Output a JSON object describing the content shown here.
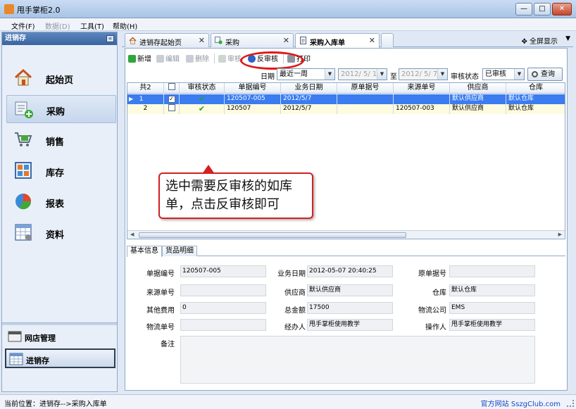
{
  "window": {
    "title": "甩手掌柜2.0",
    "min_label": "—",
    "max_label": "□",
    "close_label": "✕"
  },
  "menu": [
    {
      "label": "文件(F)",
      "disabled": false
    },
    {
      "label": "数据(D)",
      "disabled": true
    },
    {
      "label": "工具(T)",
      "disabled": false
    },
    {
      "label": "帮助(H)",
      "disabled": false
    }
  ],
  "sidebar": {
    "header": "进销存",
    "items": [
      {
        "label": "起始页",
        "icon": "home-icon"
      },
      {
        "label": "采购",
        "icon": "purchase-icon",
        "active": true
      },
      {
        "label": "销售",
        "icon": "cart-icon"
      },
      {
        "label": "库存",
        "icon": "inventory-icon"
      },
      {
        "label": "报表",
        "icon": "pie-chart-icon"
      },
      {
        "label": "资料",
        "icon": "data-grid-icon"
      }
    ],
    "bottom": [
      {
        "label": "网店管理",
        "icon": "shop-icon"
      },
      {
        "label": "进销存",
        "icon": "inventory-table-icon",
        "active": true
      }
    ]
  },
  "tabs": [
    {
      "label": "进销存起始页",
      "close": "✕"
    },
    {
      "label": "采购",
      "close": "✕"
    },
    {
      "label": "采购入库单",
      "close": "✕",
      "active": true
    }
  ],
  "fullscreen_label": "全屏显示",
  "toolbar": {
    "new_label": "新增",
    "edit_label": "编辑",
    "delete_label": "删除",
    "approve_label": "审核",
    "unapprove_label": "反审核",
    "print_label": "打印"
  },
  "filter": {
    "date_label": "日期",
    "date_range": "最近一周",
    "date_from": "2012/ 5/ 1",
    "to_label": "至",
    "date_to": "2012/ 5/ 7",
    "status_label": "审核状态",
    "status_value": "已审核",
    "query_label": "查询"
  },
  "grid": {
    "count_label": "共2",
    "columns": [
      "审核状态",
      "单据编号",
      "业务日期",
      "原单据号",
      "来源单号",
      "供应商",
      "仓库"
    ],
    "rows": [
      {
        "idx": "1",
        "checked": "✓",
        "status": "✔",
        "doc_no": "120507-005",
        "date": "2012/5/7",
        "orig_no": "",
        "src_no": "",
        "supplier": "默认供应商",
        "warehouse": "默认仓库",
        "selected": true
      },
      {
        "idx": "2",
        "checked": "",
        "status": "✔",
        "doc_no": "120507",
        "date": "2012/5/7",
        "orig_no": "",
        "src_no": "120507-003",
        "supplier": "默认供应商",
        "warehouse": "默认仓库",
        "selected": false
      }
    ]
  },
  "callout": {
    "text": "选中需要反审核的如库单，点击反审核即可"
  },
  "detail_tabs": [
    "基本信息",
    "货品明细"
  ],
  "detail": {
    "doc_no_label": "单据编号",
    "doc_no": "120507-005",
    "biz_date_label": "业务日期",
    "biz_date": "2012-05-07 20:40:25",
    "orig_no_label": "原单据号",
    "orig_no": "",
    "src_no_label": "来源单号",
    "src_no": "",
    "supplier_label": "供应商",
    "supplier": "默认供应商",
    "warehouse_label": "仓库",
    "warehouse": "默认仓库",
    "other_fee_label": "其他费用",
    "other_fee": "0",
    "total_label": "总金额",
    "total": "17500",
    "logistics_label": "物流公司",
    "logistics": "EMS",
    "tracking_label": "物流单号",
    "tracking": "",
    "handler_label": "经办人",
    "handler": "甩手掌柜使用教学",
    "operator_label": "操作人",
    "operator": "甩手掌柜使用教学",
    "remark_label": "备注",
    "remark": ""
  },
  "status": {
    "location": "当前位置：进销存-->采购入库单",
    "site": "官方网站 SszgClub.com"
  }
}
